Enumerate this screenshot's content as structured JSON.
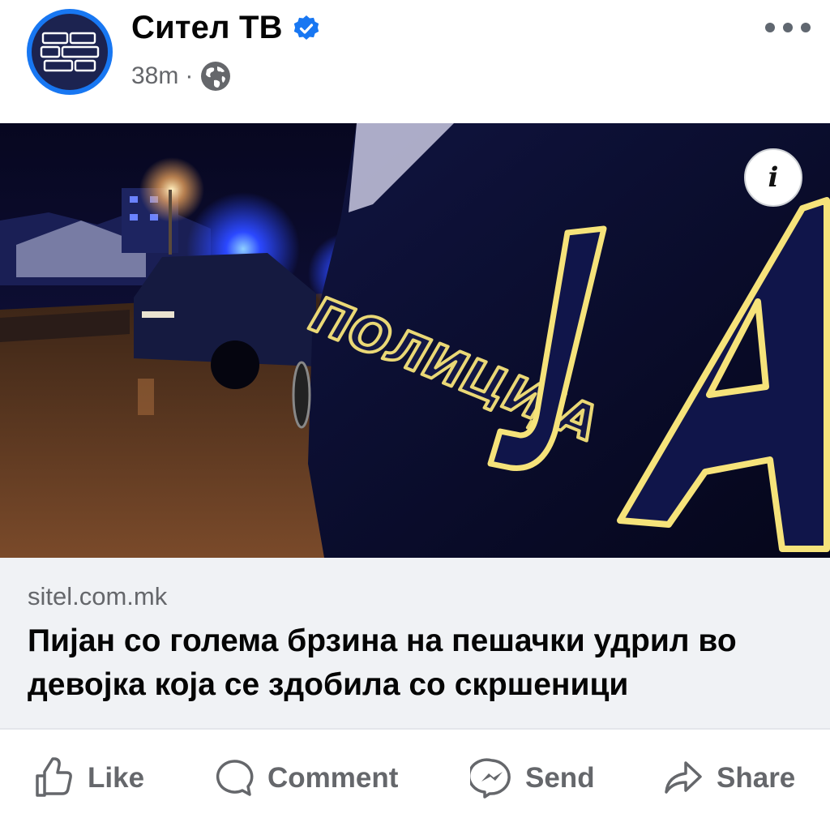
{
  "post": {
    "page_name": "Сител ТВ",
    "time": "38m",
    "separator": "·",
    "icons": {
      "verified": "verified-badge-icon",
      "audience": "globe-icon",
      "more": "more-options-icon",
      "info": "info-icon"
    },
    "image": {
      "sign_text": "ПОЛИЦИЈА",
      "info_label": "i"
    },
    "link": {
      "domain": "sitel.com.mk",
      "headline": "Пијан со голема брзина на пешачки удрил во девојка која се здобила со скршеници"
    },
    "colors": {
      "accent": "#1877f2",
      "text": "#050505",
      "secondary_text": "#65676b",
      "link_bg": "#f0f2f5"
    }
  },
  "actions": {
    "like": "Like",
    "comment": "Comment",
    "send": "Send",
    "share": "Share"
  }
}
